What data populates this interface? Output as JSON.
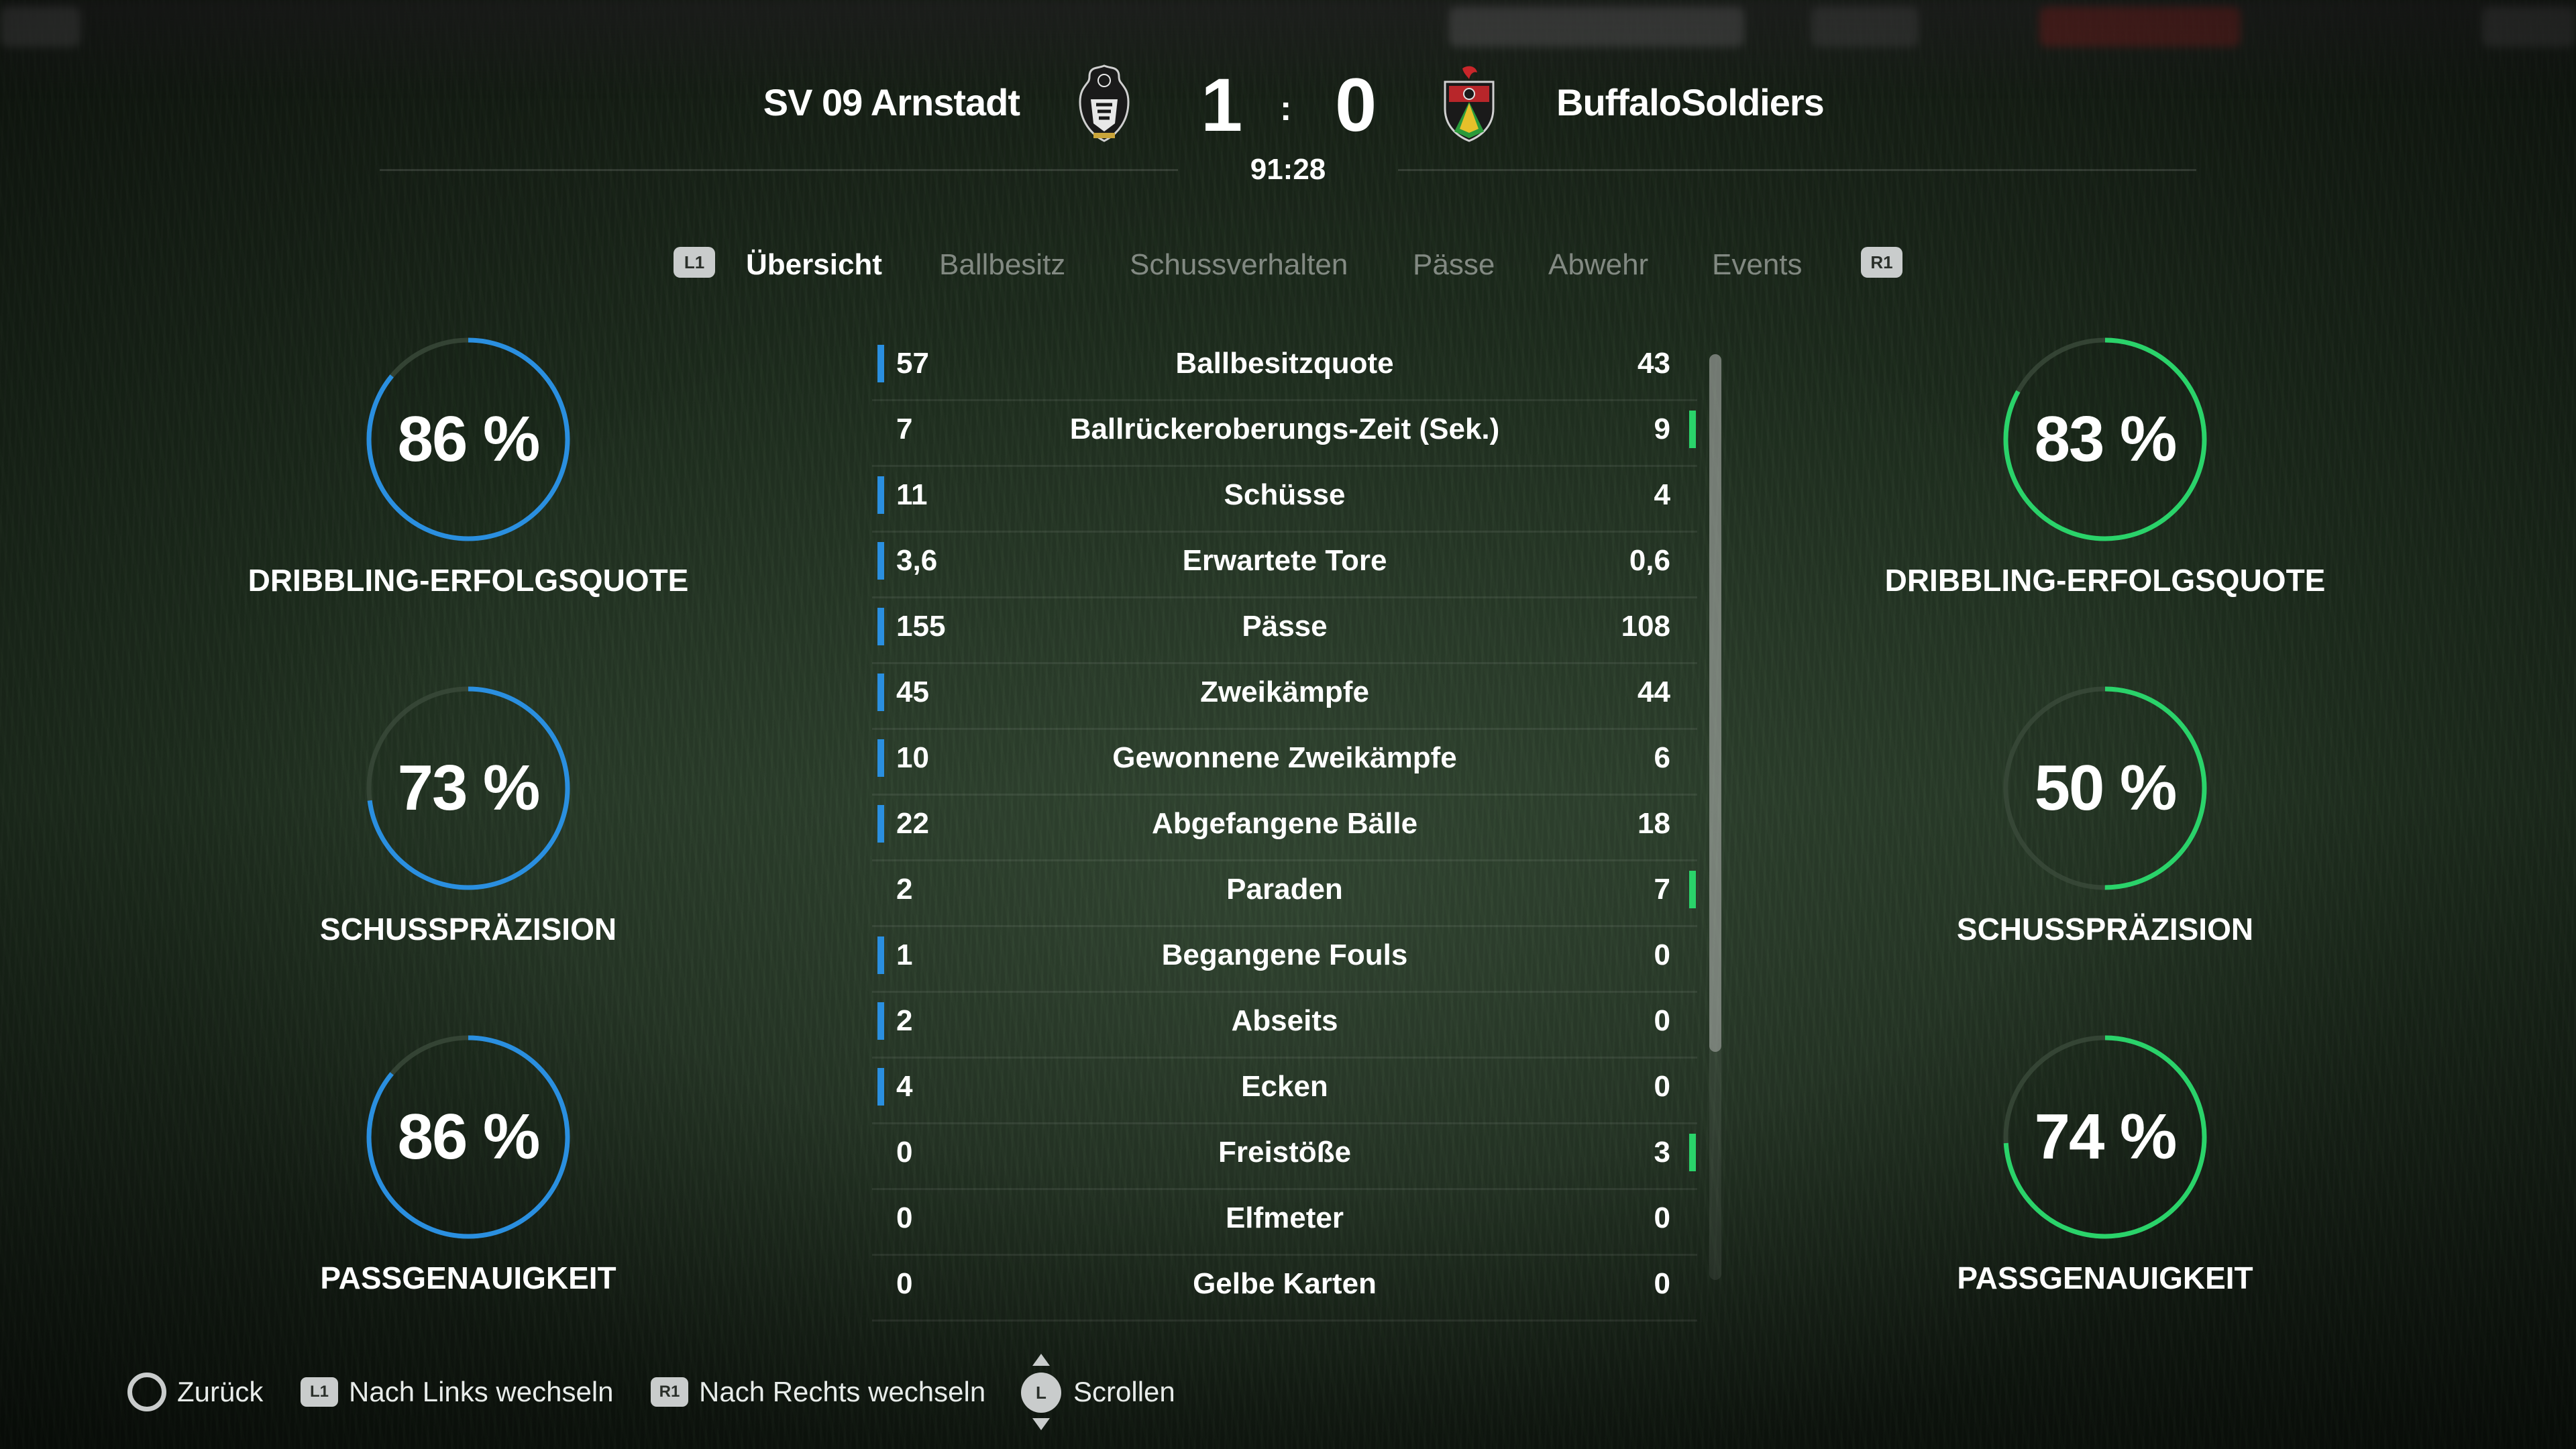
{
  "match": {
    "home_team": "SV 09 Arnstadt",
    "away_team": "BuffaloSoldiers",
    "home_score": "1",
    "away_score": "0",
    "score_separator": ":",
    "clock": "91:28"
  },
  "tabs": {
    "left_button": "L1",
    "right_button": "R1",
    "items": [
      {
        "label": "Übersicht",
        "active": true
      },
      {
        "label": "Ballbesitz",
        "active": false
      },
      {
        "label": "Schussverhalten",
        "active": false
      },
      {
        "label": "Pässe",
        "active": false
      },
      {
        "label": "Abwehr",
        "active": false
      },
      {
        "label": "Events",
        "active": false
      }
    ]
  },
  "gauges": {
    "home": [
      {
        "value": "86 %",
        "fraction": 0.86,
        "label": "DRIBBLING-ERFOLGSQUOTE"
      },
      {
        "value": "73 %",
        "fraction": 0.73,
        "label": "SCHUSSPRÄZISION"
      },
      {
        "value": "86 %",
        "fraction": 0.86,
        "label": "PASSGENAUIGKEIT"
      }
    ],
    "away": [
      {
        "value": "83 %",
        "fraction": 0.83,
        "label": "DRIBBLING-ERFOLGSQUOTE"
      },
      {
        "value": "50 %",
        "fraction": 0.5,
        "label": "SCHUSSPRÄZISION"
      },
      {
        "value": "74 %",
        "fraction": 0.74,
        "label": "PASSGENAUIGKEIT"
      }
    ],
    "home_color": "#2a8fe0",
    "away_color": "#2ad36a",
    "track_color": "#3a4a3a"
  },
  "stats": [
    {
      "label": "Ballbesitzquote",
      "home": "57",
      "away": "43",
      "leader": "home"
    },
    {
      "label": "Ballrückeroberungs-Zeit (Sek.)",
      "home": "7",
      "away": "9",
      "leader": "away"
    },
    {
      "label": "Schüsse",
      "home": "11",
      "away": "4",
      "leader": "home"
    },
    {
      "label": "Erwartete Tore",
      "home": "3,6",
      "away": "0,6",
      "leader": "home"
    },
    {
      "label": "Pässe",
      "home": "155",
      "away": "108",
      "leader": "home"
    },
    {
      "label": "Zweikämpfe",
      "home": "45",
      "away": "44",
      "leader": "home"
    },
    {
      "label": "Gewonnene Zweikämpfe",
      "home": "10",
      "away": "6",
      "leader": "home"
    },
    {
      "label": "Abgefangene Bälle",
      "home": "22",
      "away": "18",
      "leader": "home"
    },
    {
      "label": "Paraden",
      "home": "2",
      "away": "7",
      "leader": "away"
    },
    {
      "label": "Begangene Fouls",
      "home": "1",
      "away": "0",
      "leader": "home"
    },
    {
      "label": "Abseits",
      "home": "2",
      "away": "0",
      "leader": "home"
    },
    {
      "label": "Ecken",
      "home": "4",
      "away": "0",
      "leader": "home"
    },
    {
      "label": "Freistöße",
      "home": "0",
      "away": "3",
      "leader": "away"
    },
    {
      "label": "Elfmeter",
      "home": "0",
      "away": "0",
      "leader": "none"
    },
    {
      "label": "Gelbe Karten",
      "home": "0",
      "away": "0",
      "leader": "none"
    }
  ],
  "footer": {
    "back_label": "Zurück",
    "left_button": "L1",
    "left_label": "Nach Links wechseln",
    "right_button": "R1",
    "right_label": "Nach Rechts wechseln",
    "stick_button": "L",
    "scroll_label": "Scrollen"
  }
}
